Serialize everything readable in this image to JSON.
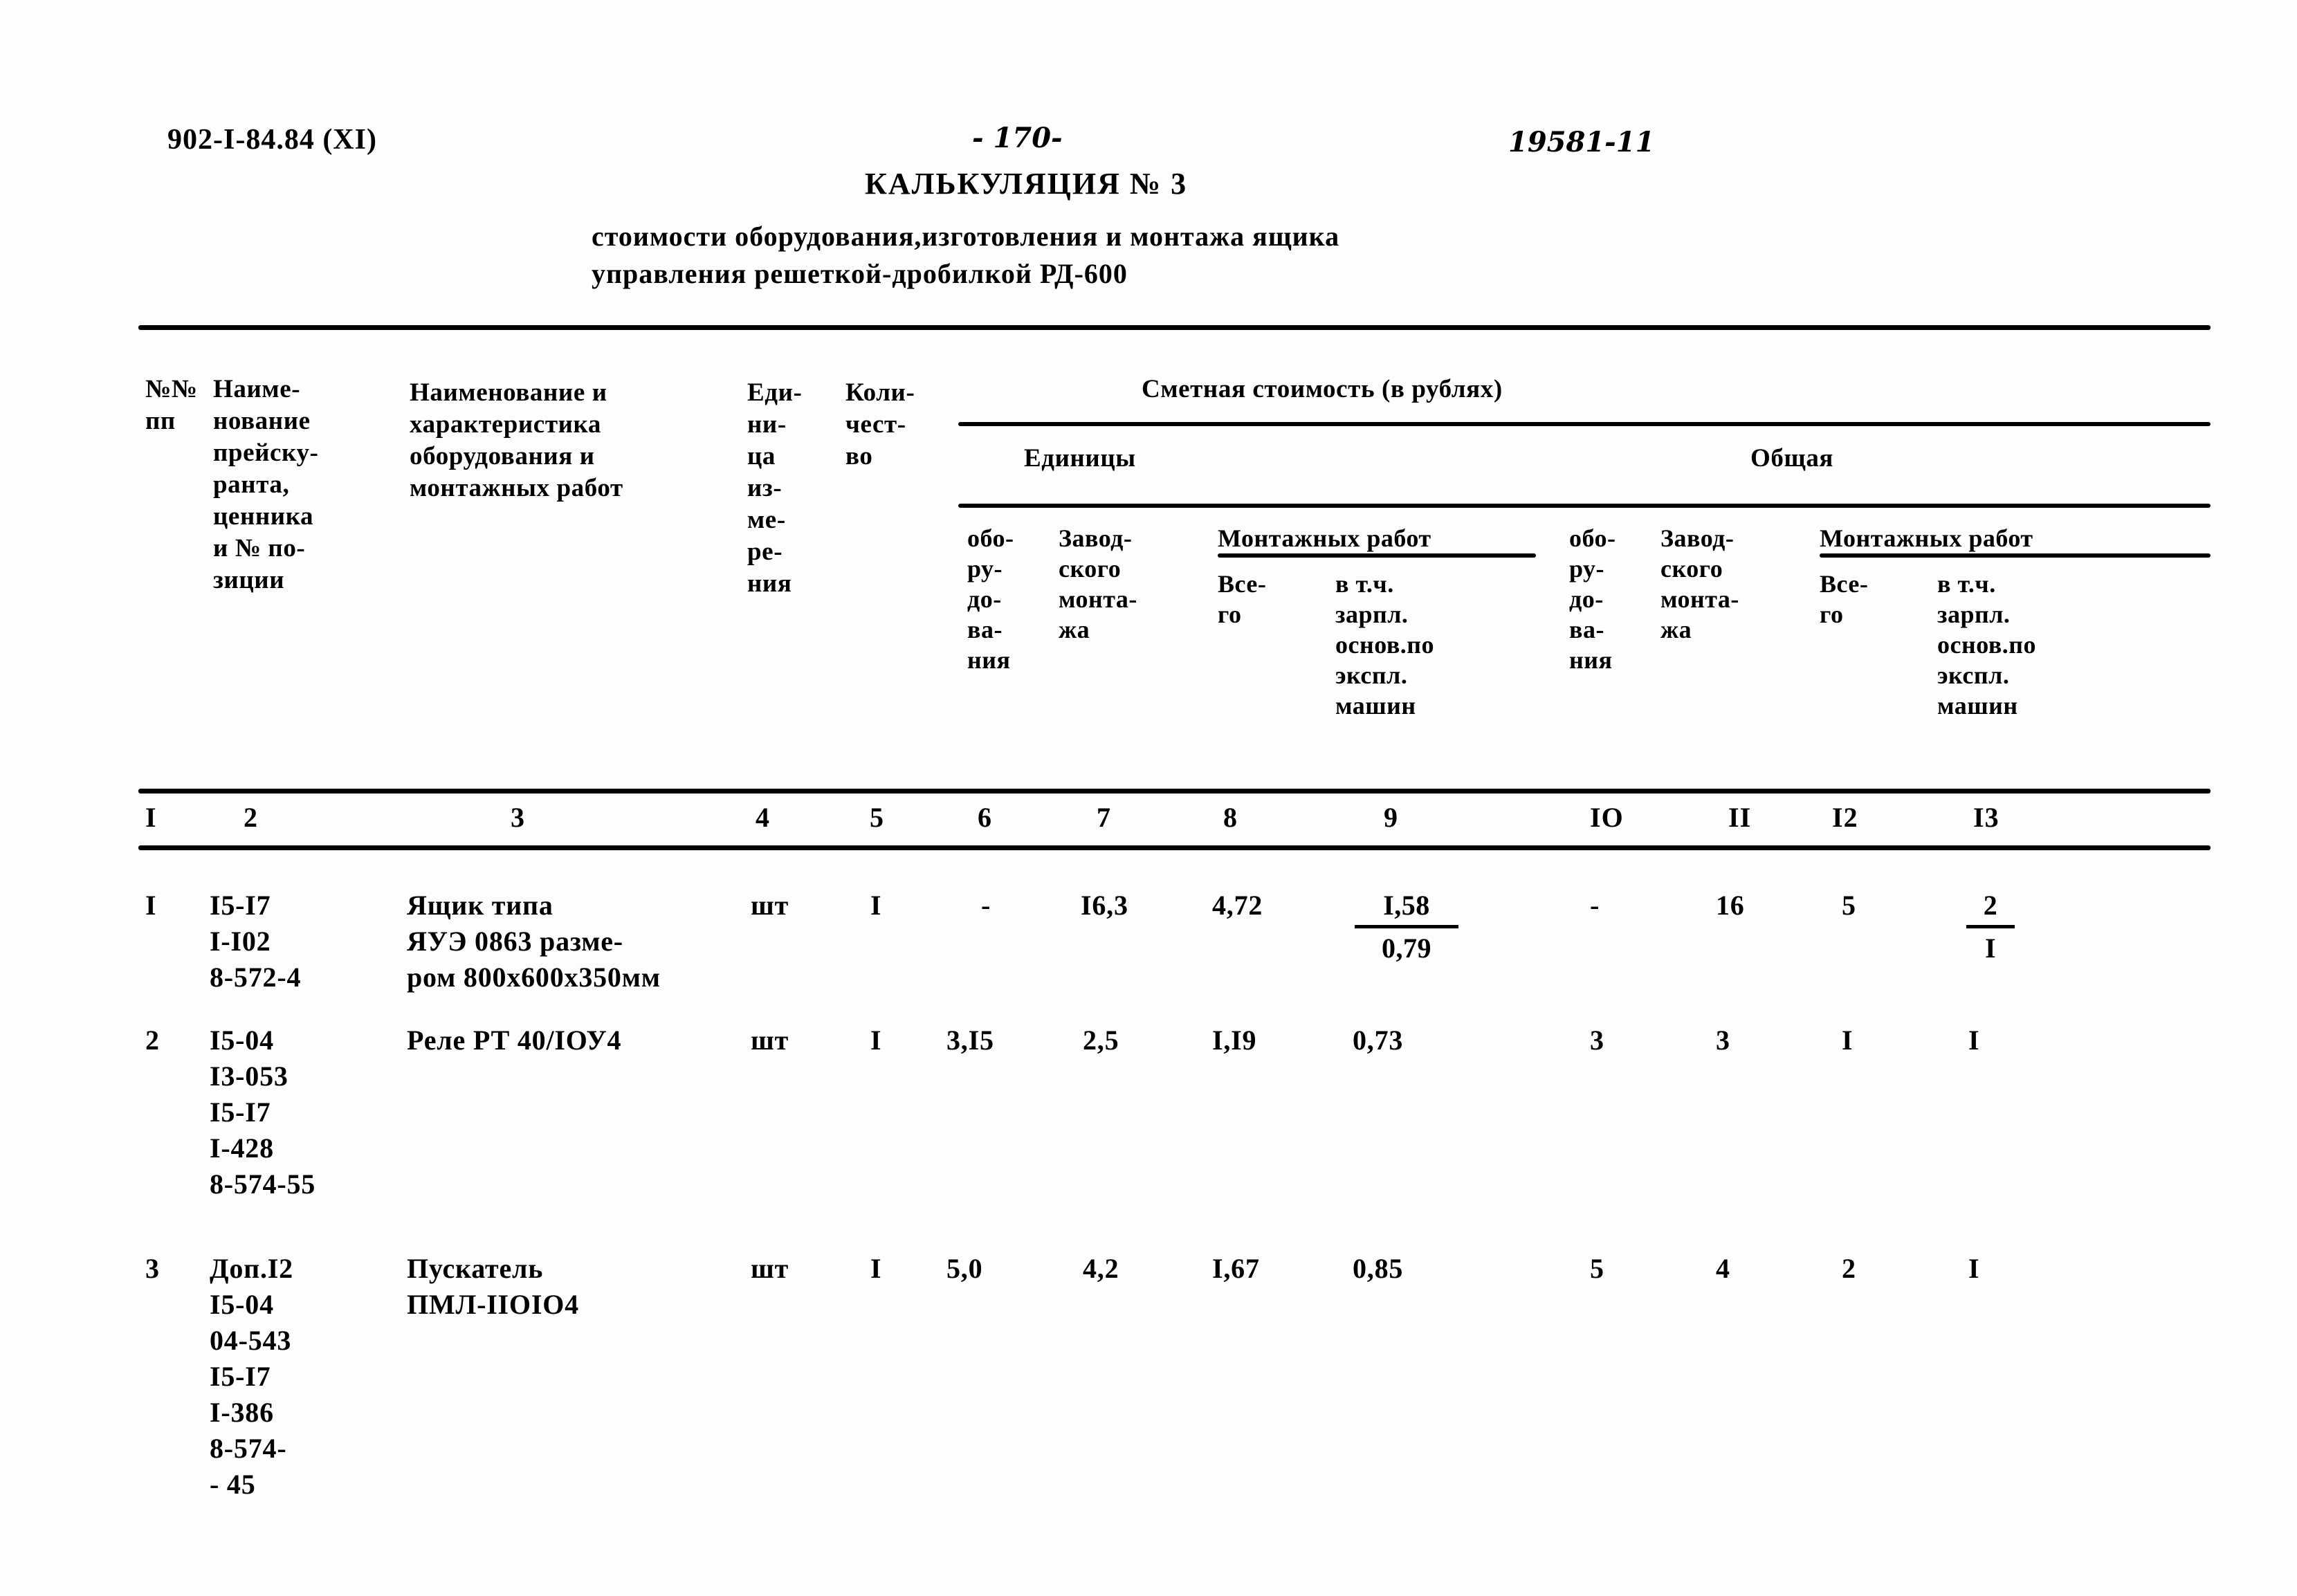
{
  "document": {
    "code": "902-I-84.84 (XI)",
    "page_number": "- 170-",
    "archive_stamp": "19581-11",
    "title": "КАЛЬКУЛЯЦИЯ № 3",
    "subtitle_line1": "стоимости оборудования,изготовления и монтажа ящика",
    "subtitle_line2": "управления решеткой-дробилкой  РД-600"
  },
  "table": {
    "headers": {
      "col1": "№№\nпп",
      "col2": "Наиме-\nнование\nпрейску-\nранта,\nценника\nи № по-\nзиции",
      "col3": "Наименование и\nхарактеристика\nоборудования и\nмонтажных работ",
      "col4": "Еди-\nни-\nца\nиз-\nме-\nре-\nния",
      "col5": "Коли-\nчест-\nво",
      "smeta": "Сметная стоимость (в рублях)",
      "group_edinicy": "Единицы",
      "group_obshaya": "Общая",
      "oborudovaniya": "обо-\nру-\nдо-\nва-\nния",
      "zavodskogo_montazha": "Завод-\nского\nмонта-\nжа",
      "montazhnyh_rabot": "Монтажных работ",
      "vsego": "Все-\nго",
      "v_tom_chisle": "в т.ч.\nзарпл.\nоснов.по\nэкспл.\nмашин"
    },
    "column_numbers": [
      "I",
      "2",
      "3",
      "4",
      "5",
      "6",
      "7",
      "8",
      "9",
      "IO",
      "II",
      "I2",
      "I3"
    ],
    "rows": [
      {
        "num": "I",
        "codes": "I5-I7\nI-I02\n8-572-4",
        "description": "Ящик типа\nЯУЭ 0863 разме-\nром 800х600х350мм",
        "unit": "шт",
        "qty": "I",
        "unit_oborud": "-",
        "unit_zavod": "I6,3",
        "unit_mont_vsego": "4,72",
        "unit_mont_vtch_num": "I,58",
        "unit_mont_vtch_den": "0,79",
        "total_oborud": "-",
        "total_zavod": "16",
        "total_mont_vsego": "5",
        "total_mont_vtch_num": "2",
        "total_mont_vtch_den": "I"
      },
      {
        "num": "2",
        "codes": "I5-04\nI3-053\nI5-I7\nI-428\n8-574-55",
        "description": "Реле РТ 40/IОУ4",
        "unit": "шт",
        "qty": "I",
        "unit_oborud": "3,I5",
        "unit_zavod": "2,5",
        "unit_mont_vsego": "I,I9",
        "unit_mont_vtch": "0,73",
        "total_oborud": "3",
        "total_zavod": "3",
        "total_mont_vsego": "I",
        "total_mont_vtch": "I"
      },
      {
        "num": "3",
        "codes": "Доп.I2\nI5-04\n04-543\nI5-I7\nI-386\n8-574-\n- 45",
        "description": "Пускатель\nПМЛ-IIOIО4",
        "unit": "шт",
        "qty": "I",
        "unit_oborud": "5,0",
        "unit_zavod": "4,2",
        "unit_mont_vsego": "I,67",
        "unit_mont_vtch": "0,85",
        "total_oborud": "5",
        "total_zavod": "4",
        "total_mont_vsego": "2",
        "total_mont_vtch": "I"
      }
    ]
  }
}
